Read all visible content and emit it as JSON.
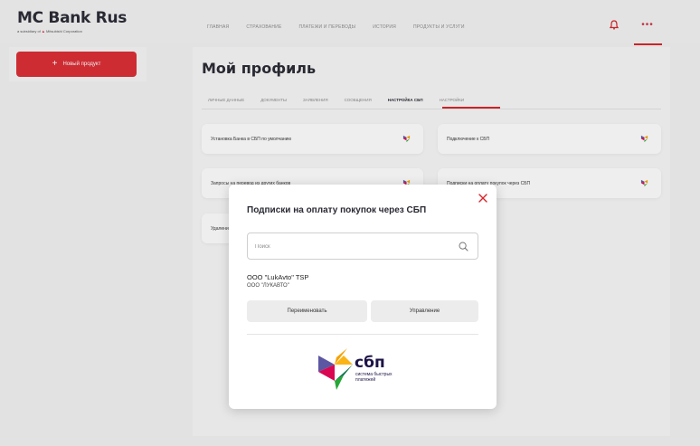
{
  "brand": {
    "name": "MC Bank Rus",
    "tagline_prefix": "a subsidiary of",
    "tagline_company": "Mitsubishi Corporation"
  },
  "nav": {
    "items": [
      {
        "label": "Главная"
      },
      {
        "label": "Страхование"
      },
      {
        "label": "Платежи и переводы"
      },
      {
        "label": "История"
      },
      {
        "label": "Продукты и услуги"
      }
    ],
    "menu_dots": "•••"
  },
  "sidebar": {
    "new_product_icon": "+",
    "new_product_label": "Новый продукт"
  },
  "page": {
    "title": "Мой профиль",
    "tabs": [
      {
        "label": "Личные данные"
      },
      {
        "label": "Документы"
      },
      {
        "label": "Заявления"
      },
      {
        "label": "Сообщения"
      },
      {
        "label": "Настройка СБП",
        "active": true
      },
      {
        "label": "Настройки"
      }
    ],
    "cards": [
      {
        "label": "Установка Банка в СБП по умолчанию"
      },
      {
        "label": "Подключение к СБП"
      },
      {
        "label": "Запросы на перевод из других банков"
      },
      {
        "label": "Подписки на оплату покупок через СБП"
      },
      {
        "label": "Удаление"
      }
    ]
  },
  "modal": {
    "title": "Подписки на оплату покупок через СБП",
    "search_placeholder": "Поиск",
    "merchant_name": "OOO \"LukAvto\" TSP",
    "merchant_legal": "ООО \"ЛУКАВТО\"",
    "rename_label": "Переименовать",
    "manage_label": "Управление",
    "sbp_logo_text": "сбп",
    "sbp_logo_sub1": "система быстрых",
    "sbp_logo_sub2": "платежей"
  },
  "colors": {
    "accent_red": "#d8232a",
    "button_red": "#dc2d35",
    "text_dark": "#2a2a35"
  },
  "icons": [
    "bell-icon",
    "more-icon",
    "plus-icon",
    "sbp-icon",
    "close-icon",
    "search-icon",
    "sbp-logo"
  ]
}
